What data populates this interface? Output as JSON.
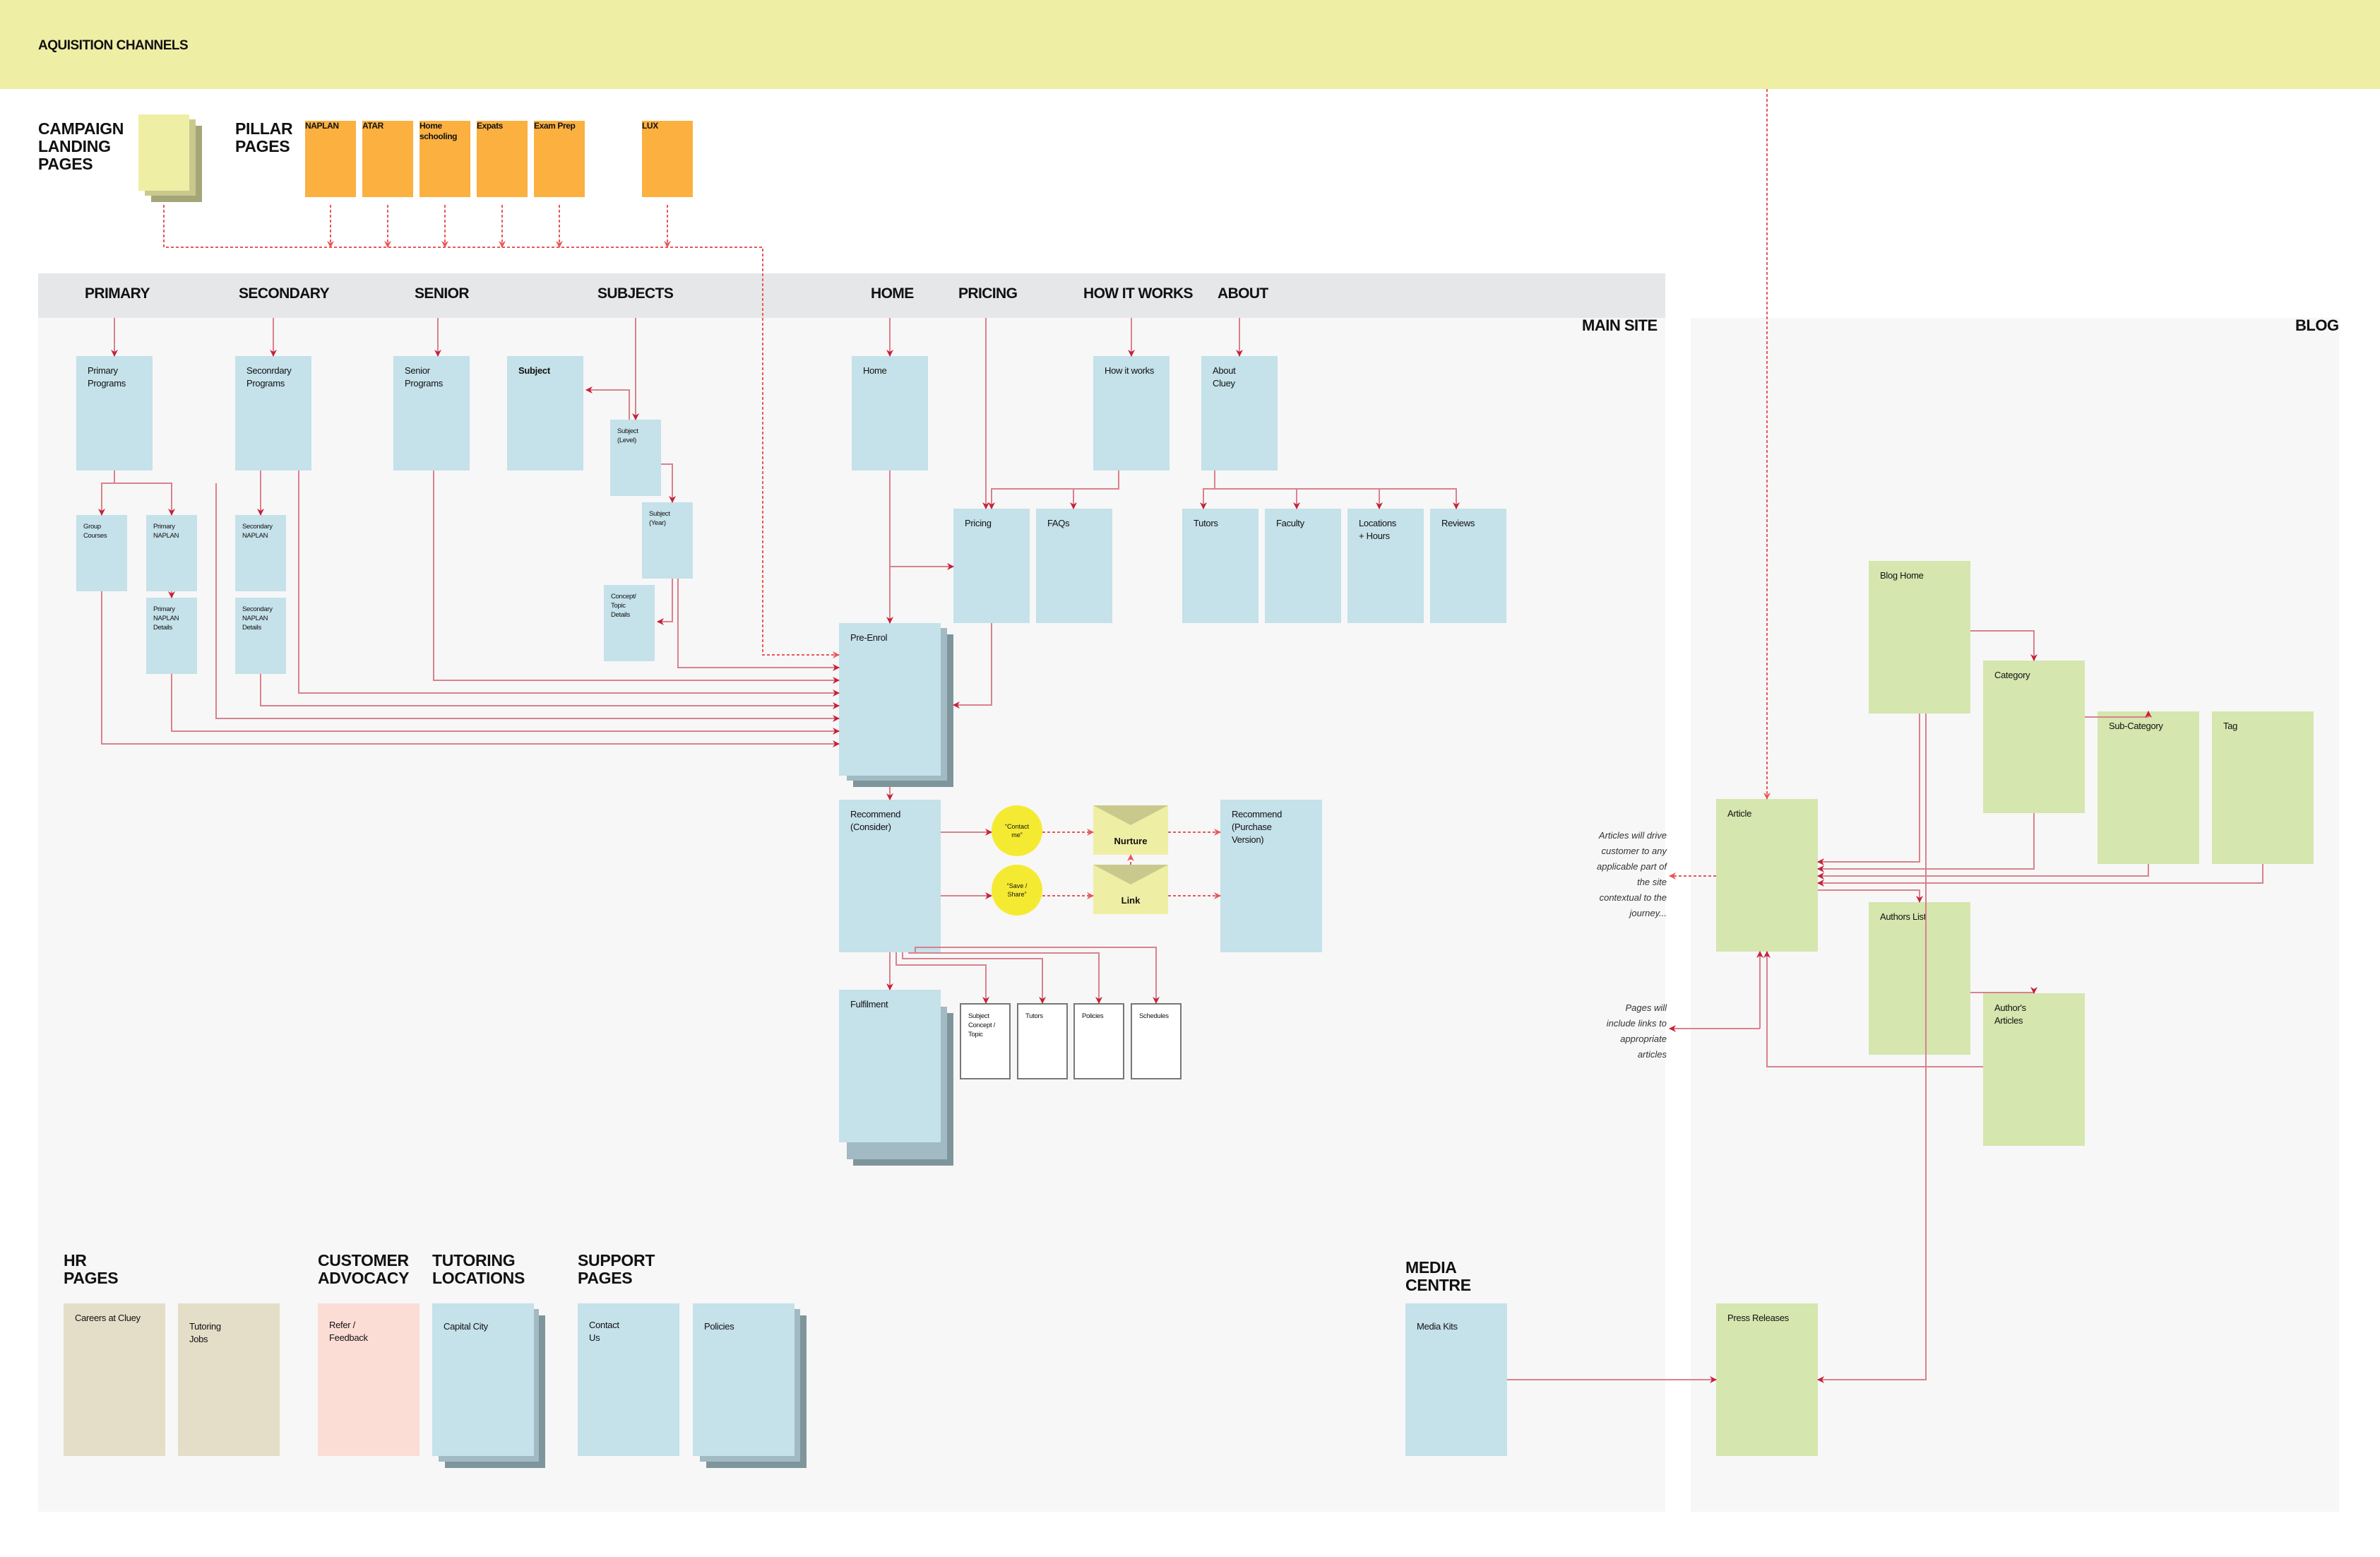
{
  "acquisition": {
    "title": "AQUISITION CHANNELS"
  },
  "campaign": {
    "heading": "CAMPAIGN\nLANDING\nPAGES"
  },
  "pillar": {
    "heading": "PILLAR\nPAGES",
    "pages": [
      "NAPLAN",
      "ATAR",
      "Home\nschooling",
      "Expats",
      "Exam Prep",
      "LUX"
    ]
  },
  "regions": {
    "main_site": "MAIN SITE",
    "blog": "BLOG"
  },
  "nav": [
    "PRIMARY",
    "SECONDARY",
    "SENIOR",
    "SUBJECTS",
    "HOME",
    "PRICING",
    "HOW IT WORKS",
    "ABOUT"
  ],
  "nodes": {
    "primary_programs": "Primary\nPrograms",
    "secondary_programs": "Seconrdary\nPrograms",
    "senior_programs": "Senior\nPrograms",
    "subject": "Subject",
    "subject_level": "Subject\n(Level)",
    "subject_year": "Subject\n(Year)",
    "concept_topic_details": "Concept/\nTopic\nDetails",
    "group_courses": "Group\nCourses",
    "primary_naplan": "Primary\nNAPLAN",
    "primary_naplan_details": "Primary\nNAPLAN\nDetails",
    "secondary_naplan": "Secondary\nNAPLAN",
    "secondary_naplan_details": "Secondary\nNAPLAN\nDetails",
    "home": "Home",
    "how_it_works": "How it works",
    "about_cluey": "About\nCluey",
    "pricing": "Pricing",
    "faqs": "FAQs",
    "tutors": "Tutors",
    "faculty": "Faculty",
    "locations_hours": "Locations\n+ Hours",
    "reviews": "Reviews",
    "pre_enrol": "Pre-Enrol",
    "recommend_consider": "Recommend\n(Consider)",
    "recommend_purchase": "Recommend\n(Purchase\nVersion)",
    "fulfilment": "Fulfilment",
    "ful_subject_concept": "Subject\nConcept /\nTopic",
    "ful_tutors": "Tutors",
    "ful_policies": "Policies",
    "ful_schedules": "Schedules",
    "contact_me": "“Contact\nme”",
    "save_share": "“Save /\nShare”",
    "nurture": "Nurture",
    "link": "Link",
    "blog_home": "Blog Home",
    "category": "Category",
    "sub_category": "Sub-Category",
    "tag": "Tag",
    "article": "Article",
    "authors_list": "Authors List",
    "authors_articles": "Author's\nArticles",
    "press_releases": "Press Releases",
    "media_kits": "Media Kits",
    "careers": "Careers at Cluey",
    "tutoring_jobs": "Tutoring\nJobs",
    "refer_feedback": "Refer /\nFeedback",
    "capital_city": "Capital City",
    "contact_us": "Contact\nUs",
    "support_policies": "Policies"
  },
  "sections": {
    "hr": "HR\nPAGES",
    "customer_advocacy": "CUSTOMER\nADVOCACY",
    "tutoring_locations": "TUTORING\nLOCATIONS",
    "support": "SUPPORT\nPAGES",
    "media_centre": "MEDIA\nCENTRE"
  },
  "notes": {
    "articles_drive": "Articles will drive\ncustomer to any\napplicable part of\nthe site\ncontextual to the\njourney...",
    "pages_links": "Pages will\ninclude links to\nappropriate\narticles"
  },
  "colors": {
    "connector": "#d9828d",
    "arrow": "#c8203a",
    "dashed": "#e8585a"
  }
}
